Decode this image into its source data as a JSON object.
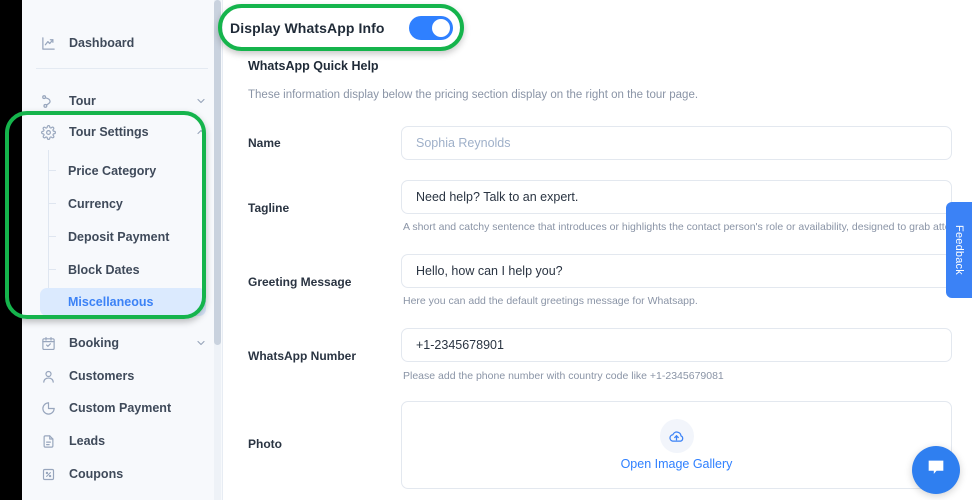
{
  "sidebar": {
    "items": [
      {
        "label": "Dashboard",
        "icon": "chart-line-icon",
        "expandable": false,
        "state": "default"
      },
      {
        "label": "Tour",
        "icon": "tour-icon",
        "expandable": true,
        "chevron": "chevron-down",
        "state": "default"
      },
      {
        "label": "Tour Settings",
        "icon": "gear-icon",
        "expandable": true,
        "chevron": "chevron-up",
        "state": "expanded"
      },
      {
        "label": "Booking",
        "icon": "calendar-check-icon",
        "expandable": true,
        "chevron": "chevron-down",
        "state": "default"
      },
      {
        "label": "Customers",
        "icon": "user-icon",
        "expandable": false,
        "state": "default"
      },
      {
        "label": "Custom Payment",
        "icon": "pie-chart-icon",
        "expandable": false,
        "state": "default"
      },
      {
        "label": "Leads",
        "icon": "document-icon",
        "expandable": false,
        "state": "default"
      },
      {
        "label": "Coupons",
        "icon": "coupon-icon",
        "expandable": false,
        "state": "default"
      }
    ],
    "sub_items": [
      {
        "label": "Price Category",
        "active": false
      },
      {
        "label": "Currency",
        "active": false
      },
      {
        "label": "Deposit Payment",
        "active": false
      },
      {
        "label": "Block Dates",
        "active": false
      },
      {
        "label": "Miscellaneous",
        "active": true
      }
    ]
  },
  "main": {
    "toggle": {
      "label": "Display WhatsApp Info",
      "state": "on"
    },
    "section": {
      "title": "WhatsApp Quick Help",
      "description": "These information display below the pricing section display on the right on the tour page."
    },
    "fields": [
      {
        "label": "Name",
        "value": "",
        "placeholder": "Sophia Reynolds",
        "is_placeholder": true,
        "help": ""
      },
      {
        "label": "Tagline",
        "value": "Need help? Talk to an expert.",
        "placeholder": "",
        "is_placeholder": false,
        "help": "A short and catchy sentence that introduces or highlights the contact person's role or availability, designed to grab attention."
      },
      {
        "label": "Greeting Message",
        "value": "Hello, how can I help you?",
        "placeholder": "",
        "is_placeholder": false,
        "help": "Here you can add the default greetings message for Whatsapp."
      },
      {
        "label": "WhatsApp Number",
        "value": "+1-2345678901",
        "placeholder": "",
        "is_placeholder": false,
        "help": "Please add the phone number with country code like +1-2345679081"
      }
    ],
    "photo": {
      "label": "Photo",
      "upload_link": "Open Image Gallery",
      "icon": "cloud-upload-icon"
    }
  },
  "feedback_tab": {
    "label": "Feedback"
  },
  "chat_fab": {
    "icon": "chat-bubble-icon"
  },
  "colors": {
    "accent_blue": "#2f80ff",
    "highlight_green": "#15b44c",
    "active_item_bg": "#dbeafe",
    "active_item_text": "#3b82f6",
    "sidebar_bg": "#f7f9fc"
  }
}
